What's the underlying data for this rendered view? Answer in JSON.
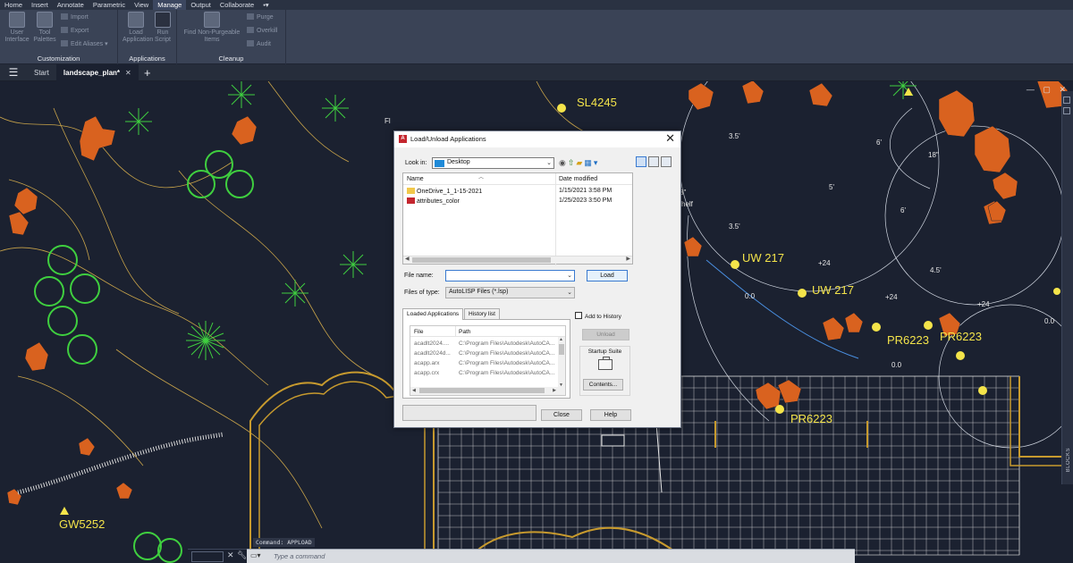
{
  "ribbon": {
    "tabs": [
      "Home",
      "Insert",
      "Annotate",
      "Parametric",
      "View",
      "Manage",
      "Output",
      "Collaborate"
    ],
    "active_tab": "Manage",
    "customization": {
      "title": "Customization",
      "user_interface": "User Interface",
      "tool_palettes": "Tool Palettes",
      "import": "Import",
      "export": "Export",
      "edit_aliases": "Edit Aliases"
    },
    "applications": {
      "title": "Applications",
      "load_application": "Load Application",
      "run_script": "Run Script"
    },
    "cleanup": {
      "title": "Cleanup",
      "find_non_purgeable": "Find Non-Purgeable Items",
      "purge": "Purge",
      "overkill": "Overkill",
      "audit": "Audit"
    }
  },
  "file_tabs": {
    "start": "Start",
    "active": "landscape_plan*"
  },
  "drawing": {
    "labels": [
      "SL4245",
      "UW 217",
      "UW 217",
      "PR6223",
      "PR6223",
      "PR6223",
      "GW5252"
    ],
    "dims": [
      "3.5'",
      "6'",
      "5'",
      "6'",
      "3.5'",
      "+24",
      "4.5'",
      "0.0",
      "+24",
      "0.0",
      "+24",
      "0.0",
      "18\"",
      "8\"",
      "helf",
      "Fl"
    ],
    "side_label": "BLOCKS"
  },
  "command": {
    "history": "Command: APPLOAD",
    "placeholder": "Type a command"
  },
  "dialog": {
    "title": "Load/Unload Applications",
    "look_in_label": "Look in:",
    "look_in_value": "Desktop",
    "col_name": "Name",
    "col_date": "Date modified",
    "files": [
      {
        "name": "OneDrive_1_1-15-2021",
        "date": "1/15/2021 3:58 PM",
        "type": "folder"
      },
      {
        "name": "attributes_color",
        "date": "1/25/2023 3:50 PM",
        "type": "lsp"
      }
    ],
    "file_name_label": "File name:",
    "file_name_value": "",
    "load_button": "Load",
    "files_of_type_label": "Files of type:",
    "files_of_type_value": "AutoLISP Files (*.lsp)",
    "tab_loaded": "Loaded Applications",
    "tab_history": "History list",
    "loaded_col_file": "File",
    "loaded_col_path": "Path",
    "loaded_apps": [
      {
        "file": "acadlt2024....",
        "path": "C:\\Program Files\\Autodesk\\AutoCA..."
      },
      {
        "file": "acadlt2024d...",
        "path": "C:\\Program Files\\Autodesk\\AutoCA..."
      },
      {
        "file": "acapp.arx",
        "path": "C:\\Program Files\\Autodesk\\AutoCA..."
      },
      {
        "file": "acapp.crx",
        "path": "C:\\Program Files\\Autodesk\\AutoCA..."
      }
    ],
    "add_to_history": "Add to History",
    "unload_button": "Unload",
    "startup_suite": "Startup Suite",
    "contents_button": "Contents...",
    "close_button": "Close",
    "help_button": "Help"
  },
  "colors": {
    "drawing_bg": "#1b2130",
    "annotation_yellow": "#f4e44a",
    "tree_orange": "#d9621f",
    "shrub_green": "#3fcf3f",
    "contour_tan": "#c9a44a"
  }
}
